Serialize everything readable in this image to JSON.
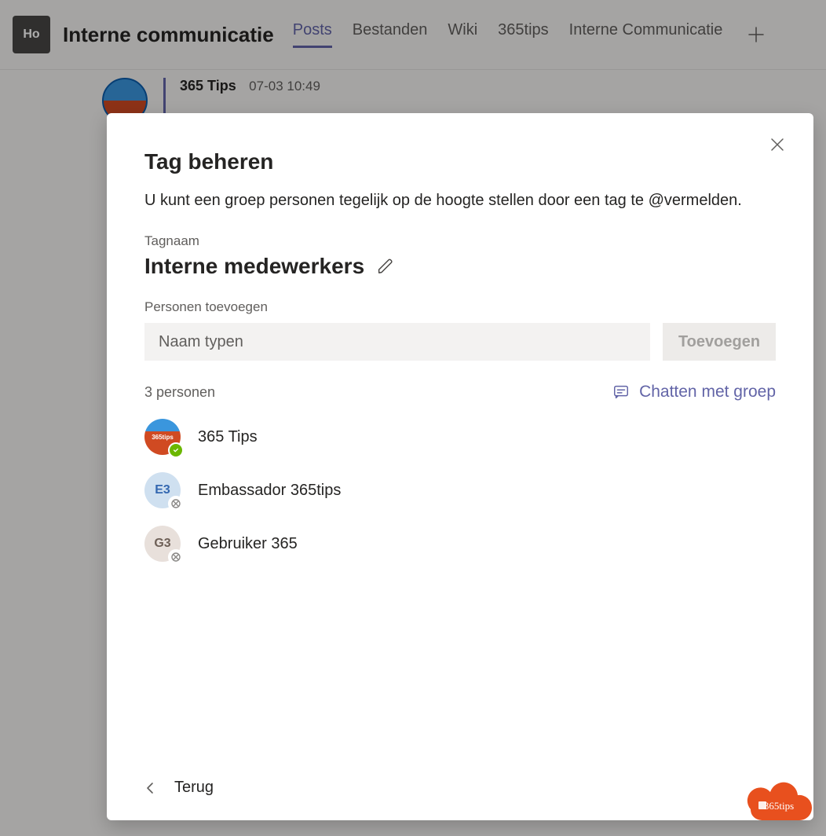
{
  "header": {
    "team_icon_text": "Ho",
    "channel_title": "Interne communicatie",
    "tabs": [
      "Posts",
      "Bestanden",
      "Wiki",
      "365tips",
      "Interne Communicatie"
    ],
    "active_tab_index": 0
  },
  "post": {
    "author": "365 Tips",
    "time": "07-03 10:49"
  },
  "modal": {
    "title": "Tag beheren",
    "subtitle": "U kunt een groep personen tegelijk op de hoogte stellen door een tag te @vermelden.",
    "tagname_label": "Tagnaam",
    "tag_name": "Interne medewerkers",
    "add_people_label": "Personen toevoegen",
    "name_placeholder": "Naam typen",
    "add_button": "Toevoegen",
    "count_text": "3 personen",
    "chat_link": "Chatten met groep",
    "people": [
      {
        "name": "365 Tips",
        "initials": "",
        "avatar_color": "#d04a22",
        "avatar_type": "logo",
        "status": "available"
      },
      {
        "name": "Embassador 365tips",
        "initials": "E3",
        "avatar_color": "#cfe0f0",
        "avatar_text_color": "#3367b0",
        "avatar_type": "initials",
        "status": "offline"
      },
      {
        "name": "Gebruiker 365",
        "initials": "G3",
        "avatar_color": "#e8e0db",
        "avatar_text_color": "#6e6057",
        "avatar_type": "initials",
        "status": "offline"
      }
    ],
    "back": "Terug"
  },
  "brand": {
    "label": "365tips",
    "bg": "#e8501e"
  }
}
